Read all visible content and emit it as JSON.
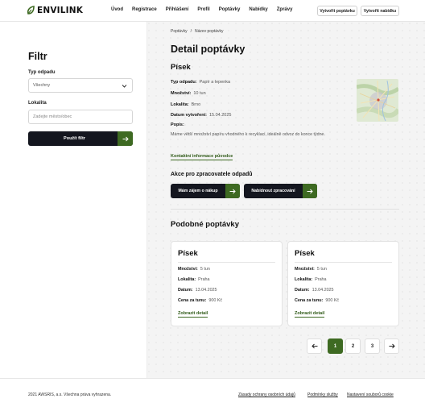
{
  "brand": {
    "name": "ENVILINK",
    "accent": "#3e6a22",
    "dark": "#14161f"
  },
  "nav": [
    "Úvod",
    "Registrace",
    "Přihlášení",
    "Profil",
    "Poptávky",
    "Nabídky",
    "Zprávy"
  ],
  "header_buttons": {
    "create_request": "Vytvořit poptávku",
    "create_offer": "Vytvořit nabídku"
  },
  "filter": {
    "title": "Filtr",
    "type_label": "Typ odpadu",
    "type_value": "Všechny",
    "location_label": "Lokalita",
    "location_placeholder": "Zadejte město/obec",
    "apply_button": "Použít filtr"
  },
  "breadcrumb": {
    "root": "Poptávky",
    "sep": "/",
    "current": "Název poptávky"
  },
  "detail": {
    "title": "Detail poptávky",
    "location": "Písek",
    "fields": [
      {
        "label": "Typ odpadu:",
        "value": "Papír a lepenka"
      },
      {
        "label": "Množství:",
        "value": "10 tun"
      },
      {
        "label": "Lokalita:",
        "value": "Brno"
      },
      {
        "label": "Datum vytvoření:",
        "value": "15.04.2025"
      }
    ],
    "desc_label": "Popis:",
    "desc": "Máme větší množství papíru vhodného k recyklaci, ideálně odvoz do konce týdne.",
    "contact_link": "Kontaktní informace původce",
    "actions_title": "Akce pro zpracovatele odpadů",
    "interest_button": "Mám zájem o nákup",
    "offer_button": "Nabídnout zpracování",
    "map_label": "Brno"
  },
  "similar": {
    "title": "Podobné poptávky",
    "cards": [
      {
        "title": "Písek",
        "rows": [
          {
            "label": "Množství:",
            "value": "5 tun"
          },
          {
            "label": "Lokalita:",
            "value": "Praha"
          },
          {
            "label": "Datum:",
            "value": "13.04.2025"
          },
          {
            "label": "Cena za tunu:",
            "value": "900 Kč"
          }
        ],
        "link": "Zobrazit detail"
      },
      {
        "title": "Písek",
        "rows": [
          {
            "label": "Množství:",
            "value": "5 tun"
          },
          {
            "label": "Lokalita:",
            "value": "Praha"
          },
          {
            "label": "Datum:",
            "value": "13.04.2025"
          },
          {
            "label": "Cena za tunu:",
            "value": "900 Kč"
          }
        ],
        "link": "Zobrazit detail"
      }
    ]
  },
  "pagination": {
    "pages": [
      "1",
      "2",
      "3"
    ],
    "current": "1",
    "prev_icon": "arrow-left-icon",
    "next_icon": "arrow-right-icon"
  },
  "footer": {
    "copyright": "2021 AWSRIS, a.s. Všechna práva vyhrazena.",
    "links": [
      "Zásady ochrany osobních údajů",
      "Podmínky služby",
      "Nastavení souborů cookie"
    ]
  }
}
